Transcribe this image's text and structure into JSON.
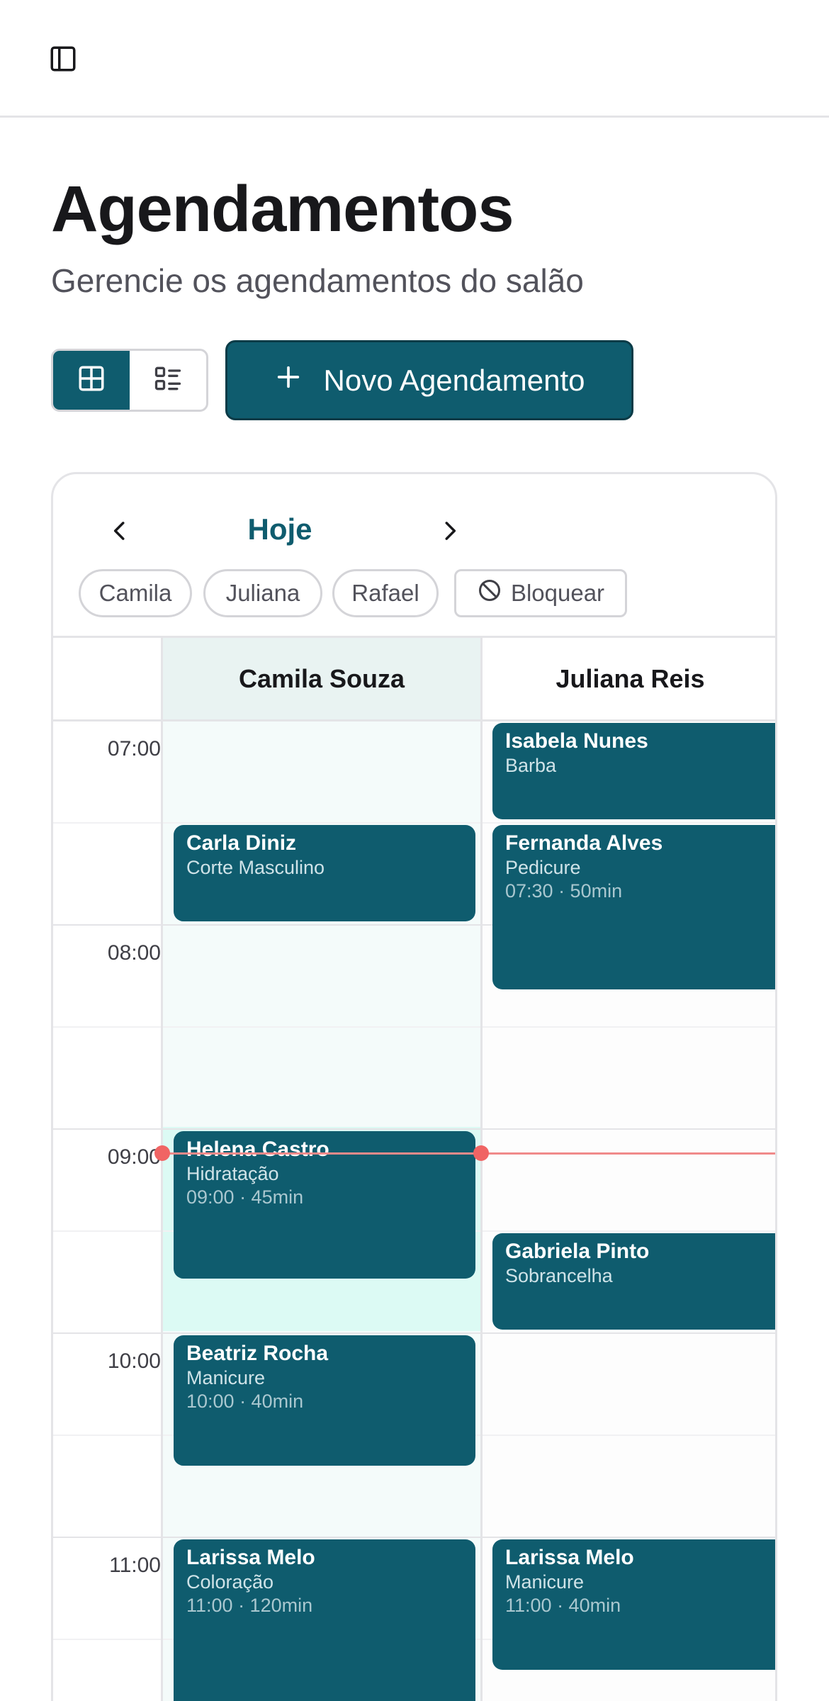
{
  "header": {
    "toggle_icon": "sidebar-toggle-icon"
  },
  "page": {
    "title": "Agendamentos",
    "subtitle": "Gerencie os agendamentos do salão"
  },
  "toolbar": {
    "view_grid_icon": "grid-view-icon",
    "view_list_icon": "list-view-icon",
    "new_button_label": "Novo Agendamento",
    "new_button_icon": "plus-icon"
  },
  "calendar": {
    "today_label": "Hoje",
    "filters": [
      "Camila",
      "Juliana",
      "Rafael"
    ],
    "block_label": "Bloquear",
    "columns": [
      "Camila Souza",
      "Juliana Reis"
    ],
    "times": [
      "07:00",
      "08:00",
      "09:00",
      "10:00",
      "11:00"
    ],
    "appointments": [
      {
        "name": "Carla Diniz",
        "service": "Corte Masculino",
        "time": ""
      },
      {
        "name": "Helena Castro",
        "service": "Hidratação",
        "time": "09:00 · 45min"
      },
      {
        "name": "Beatriz Rocha",
        "service": "Manicure",
        "time": "10:00 · 40min"
      },
      {
        "name": "Larissa Melo",
        "service": "Coloração",
        "time": "11:00 · 120min"
      },
      {
        "name": "Isabela Nunes",
        "service": "Barba",
        "time": ""
      },
      {
        "name": "Fernanda Alves",
        "service": "Pedicure",
        "time": "07:30 · 50min"
      },
      {
        "name": "Gabriela Pinto",
        "service": "Sobrancelha",
        "time": ""
      },
      {
        "name": "Larissa Melo",
        "service": "Manicure",
        "time": "11:00 · 40min"
      }
    ]
  },
  "colors": {
    "primary": "#0f5c6e",
    "selected_column_bg": "#f4fbfa",
    "selected_header_bg": "#e9f3f2",
    "now_line": "#f08a8a"
  }
}
